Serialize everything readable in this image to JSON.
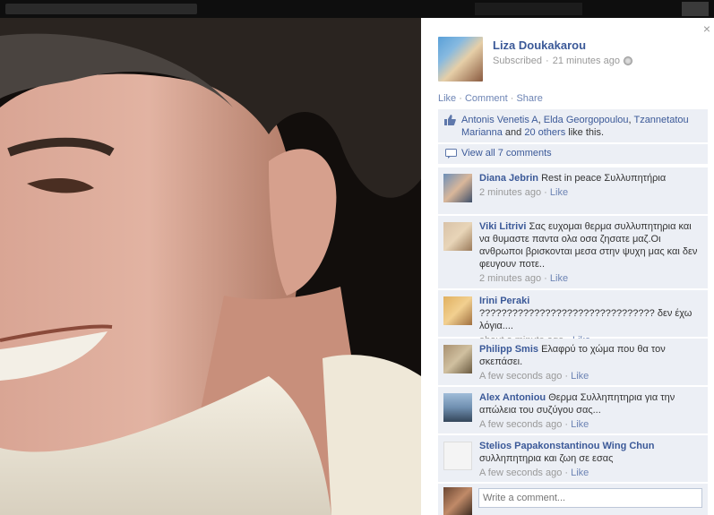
{
  "post": {
    "owner_name": "Liza Doukakarou",
    "status": "Subscribed",
    "timestamp": "21 minutes ago",
    "privacy_icon": "globe-icon"
  },
  "actions": {
    "like": "Like",
    "comment": "Comment",
    "share": "Share"
  },
  "likes": {
    "names": [
      "Antonis Venetis A",
      "Elda Georgopoulou",
      "Tzannetatou Marianna"
    ],
    "and_text": "and",
    "others": "20 others",
    "suffix": "like this."
  },
  "view_all": "View all 7 comments",
  "comments": [
    {
      "name": "Diana Jebrin",
      "text": "Rest in peace Συλλυπητήρια",
      "time": "2 minutes ago",
      "like": "Like"
    },
    {
      "name": "Viki Litrivi",
      "text": "Σας ευχομαι θερμα συλλυπητηρια και να θυμαστε παντα ολα οσα ζησατε μαζ.Οι ανθρωποι βρισκονται μεσα στην ψυχη μας και δεν φευγουν ποτε..",
      "time": "2 minutes ago",
      "like": "Like"
    },
    {
      "name": "Irini Peraki",
      "text": "???????????????????????????????? δεν έχω λόγια....",
      "time": "about a minute ago",
      "like": "Like"
    },
    {
      "name": "Philipp Smis",
      "text": "Ελαφρύ το χώμα που θα τον σκεπάσει.",
      "time": "A few seconds ago",
      "like": "Like"
    },
    {
      "name": "Alex Antoniou",
      "text": "Θερμα Συλληπητηρια για την απώλεια του συζύγου σας...",
      "time": "A few seconds ago",
      "like": "Like"
    },
    {
      "name": "Stelios Papakonstantinou Wing Chun",
      "text": "συλληπητηρια και ζωη σε εσας",
      "time": "A few seconds ago",
      "like": "Like"
    }
  ],
  "write_placeholder": "Write a comment...",
  "colors": {
    "link": "#3b5998",
    "panel_bg": "#eceff5",
    "meta": "#999999"
  }
}
